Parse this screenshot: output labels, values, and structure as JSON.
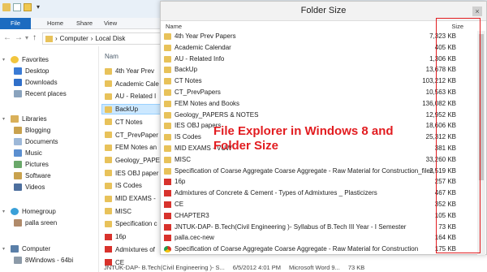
{
  "explorer": {
    "ribbon_tabs": [
      "File",
      "Home",
      "Share",
      "View"
    ],
    "address": {
      "items": [
        "Computer",
        "Local Disk"
      ],
      "separator": "›"
    },
    "nav": {
      "back": "←",
      "forward": "→",
      "recent": "▾",
      "up": "↑"
    },
    "sidebar": [
      {
        "label": "Favorites",
        "icon": "star-icon"
      },
      {
        "label": "Desktop",
        "icon": "desktop-icon"
      },
      {
        "label": "Downloads",
        "icon": "downloads-icon"
      },
      {
        "label": "Recent places",
        "icon": "recent-places-icon"
      },
      {
        "label": "Libraries",
        "icon": "libraries-icon"
      },
      {
        "label": "Blogging",
        "icon": "library-icon"
      },
      {
        "label": "Documents",
        "icon": "documents-icon"
      },
      {
        "label": "Music",
        "icon": "music-icon"
      },
      {
        "label": "Pictures",
        "icon": "pictures-icon"
      },
      {
        "label": "Software",
        "icon": "library-icon"
      },
      {
        "label": "Videos",
        "icon": "videos-icon"
      },
      {
        "label": "Homegroup",
        "icon": "homegroup-icon"
      },
      {
        "label": "palla sreen",
        "icon": "user-icon"
      },
      {
        "label": "Computer",
        "icon": "computer-icon"
      },
      {
        "label": "8Windows - 64bi",
        "icon": "drive-icon"
      }
    ],
    "list_header": "Nam",
    "list_items": [
      "4th Year Prev",
      "Academic Cale",
      "AU - Related I",
      "BackUp",
      "CT Notes",
      "CT_PrevPaper",
      "FEM Notes an",
      "Geology_PAPE",
      "IES OBJ paper",
      "IS Codes",
      "MID EXAMS -",
      "MISC",
      "Specification c",
      "16p",
      "Admixtures of",
      "CE",
      "CHAPTER3"
    ],
    "selected_item": "BackUp",
    "bottom_row": {
      "name": "JNTUK-DAP- B.Tech(Civil Engineering )- S...",
      "date": "6/5/2012 4:01 PM",
      "type": "Microsoft Word 9...",
      "size": "73 KB"
    }
  },
  "dialog": {
    "title": "Folder Size",
    "close": "×",
    "col_name": "Name",
    "col_size": "Size",
    "rows": [
      {
        "name": "4th Year Prev Papers",
        "size": "7,323 KB",
        "icon": "folder-icon"
      },
      {
        "name": "Academic Calendar",
        "size": "405 KB",
        "icon": "folder-icon"
      },
      {
        "name": "AU - Related Info",
        "size": "1,306 KB",
        "icon": "folder-icon"
      },
      {
        "name": "BackUp",
        "size": "13,678 KB",
        "icon": "folder-icon"
      },
      {
        "name": "CT Notes",
        "size": "103,212 KB",
        "icon": "folder-icon"
      },
      {
        "name": "CT_PrevPapers",
        "size": "10,563 KB",
        "icon": "folder-icon"
      },
      {
        "name": "FEM Notes and Books",
        "size": "136,082 KB",
        "icon": "folder-icon"
      },
      {
        "name": "Geology_PAPERS & NOTES",
        "size": "12,952 KB",
        "icon": "folder-icon"
      },
      {
        "name": "IES OBJ papers",
        "size": "18,606 KB",
        "icon": "folder-icon"
      },
      {
        "name": "IS Codes",
        "size": "25,312 KB",
        "icon": "folder-icon"
      },
      {
        "name": "MID EXAMS - VUW",
        "size": "381 KB",
        "icon": "folder-icon"
      },
      {
        "name": "MISC",
        "size": "33,260 KB",
        "icon": "folder-icon"
      },
      {
        "name": "Specification of Coarse Aggregate   Coarse Aggregate - Raw Material for Construction_files",
        "size": "2,519 KB",
        "icon": "folder-icon"
      },
      {
        "name": "16p",
        "size": "257 KB",
        "icon": "pdf-icon"
      },
      {
        "name": "Admixtures of Concrete & Cement - Types of Admixtures _ Plasticizers",
        "size": "467 KB",
        "icon": "pdf-icon"
      },
      {
        "name": "CE",
        "size": "352 KB",
        "icon": "pdf-icon"
      },
      {
        "name": "CHAPTER3",
        "size": "105 KB",
        "icon": "pdf-icon"
      },
      {
        "name": "JNTUK-DAP- B.Tech(Civil Engineering )- Syllabus of B.Tech III Year - I Semester",
        "size": "73 KB",
        "icon": "pdf-icon"
      },
      {
        "name": "palla.cec-new",
        "size": "164 KB",
        "icon": "pdf-icon"
      },
      {
        "name": "Specification of Coarse Aggregate   Coarse Aggregate - Raw Material for Construction",
        "size": "175 KB",
        "icon": "chrome-icon"
      }
    ]
  },
  "annotation": {
    "line1": "File Explorer in Windows 8 and",
    "line2": "Folder Size",
    "color": "#e21c20"
  }
}
